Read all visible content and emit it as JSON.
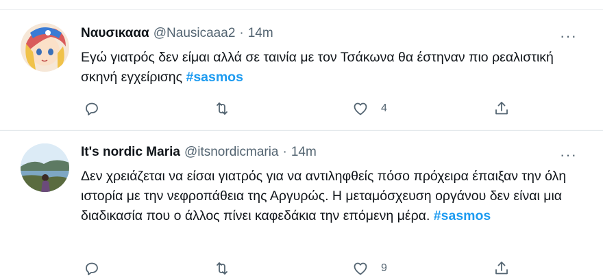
{
  "tweets": [
    {
      "name": "Ναυσικααα",
      "handle": "@Nausicaaa2",
      "separator": "·",
      "time": "14m",
      "text": "Εγώ γιατρός δεν είμαι αλλά σε ταινία με τον Τσάκωνα θα έστηναν πιο ρεαλιστική σκηνή εγχείρισης ",
      "hashtag": "#sasmos",
      "like_count": "4",
      "avatar_icon": "anime-girl-avatar"
    },
    {
      "name": "It's nordic Maria",
      "handle": "@itsnordicmaria",
      "separator": "·",
      "time": "14m",
      "text": "Δεν χρειάζεται να είσαι γιατρός για να αντιληφθείς πόσο πρόχειρα έπαιξαν την όλη ιστορία με την νεφροπάθεια της Αργυρώς. Η μεταμόσχευση οργάνου δεν είναι μια διαδικασία που ο άλλος πίνει καφεδάκια την επόμενη μέρα. ",
      "hashtag": "#sasmos",
      "like_count": "9",
      "avatar_icon": "landscape-photo-avatar"
    }
  ],
  "more_label": "···",
  "icons": [
    "reply-icon",
    "retweet-icon",
    "like-icon",
    "share-icon"
  ],
  "colors": {
    "hashtag": "#1d9bf0",
    "secondary_text": "#536471",
    "divider": "#e7ebee"
  }
}
